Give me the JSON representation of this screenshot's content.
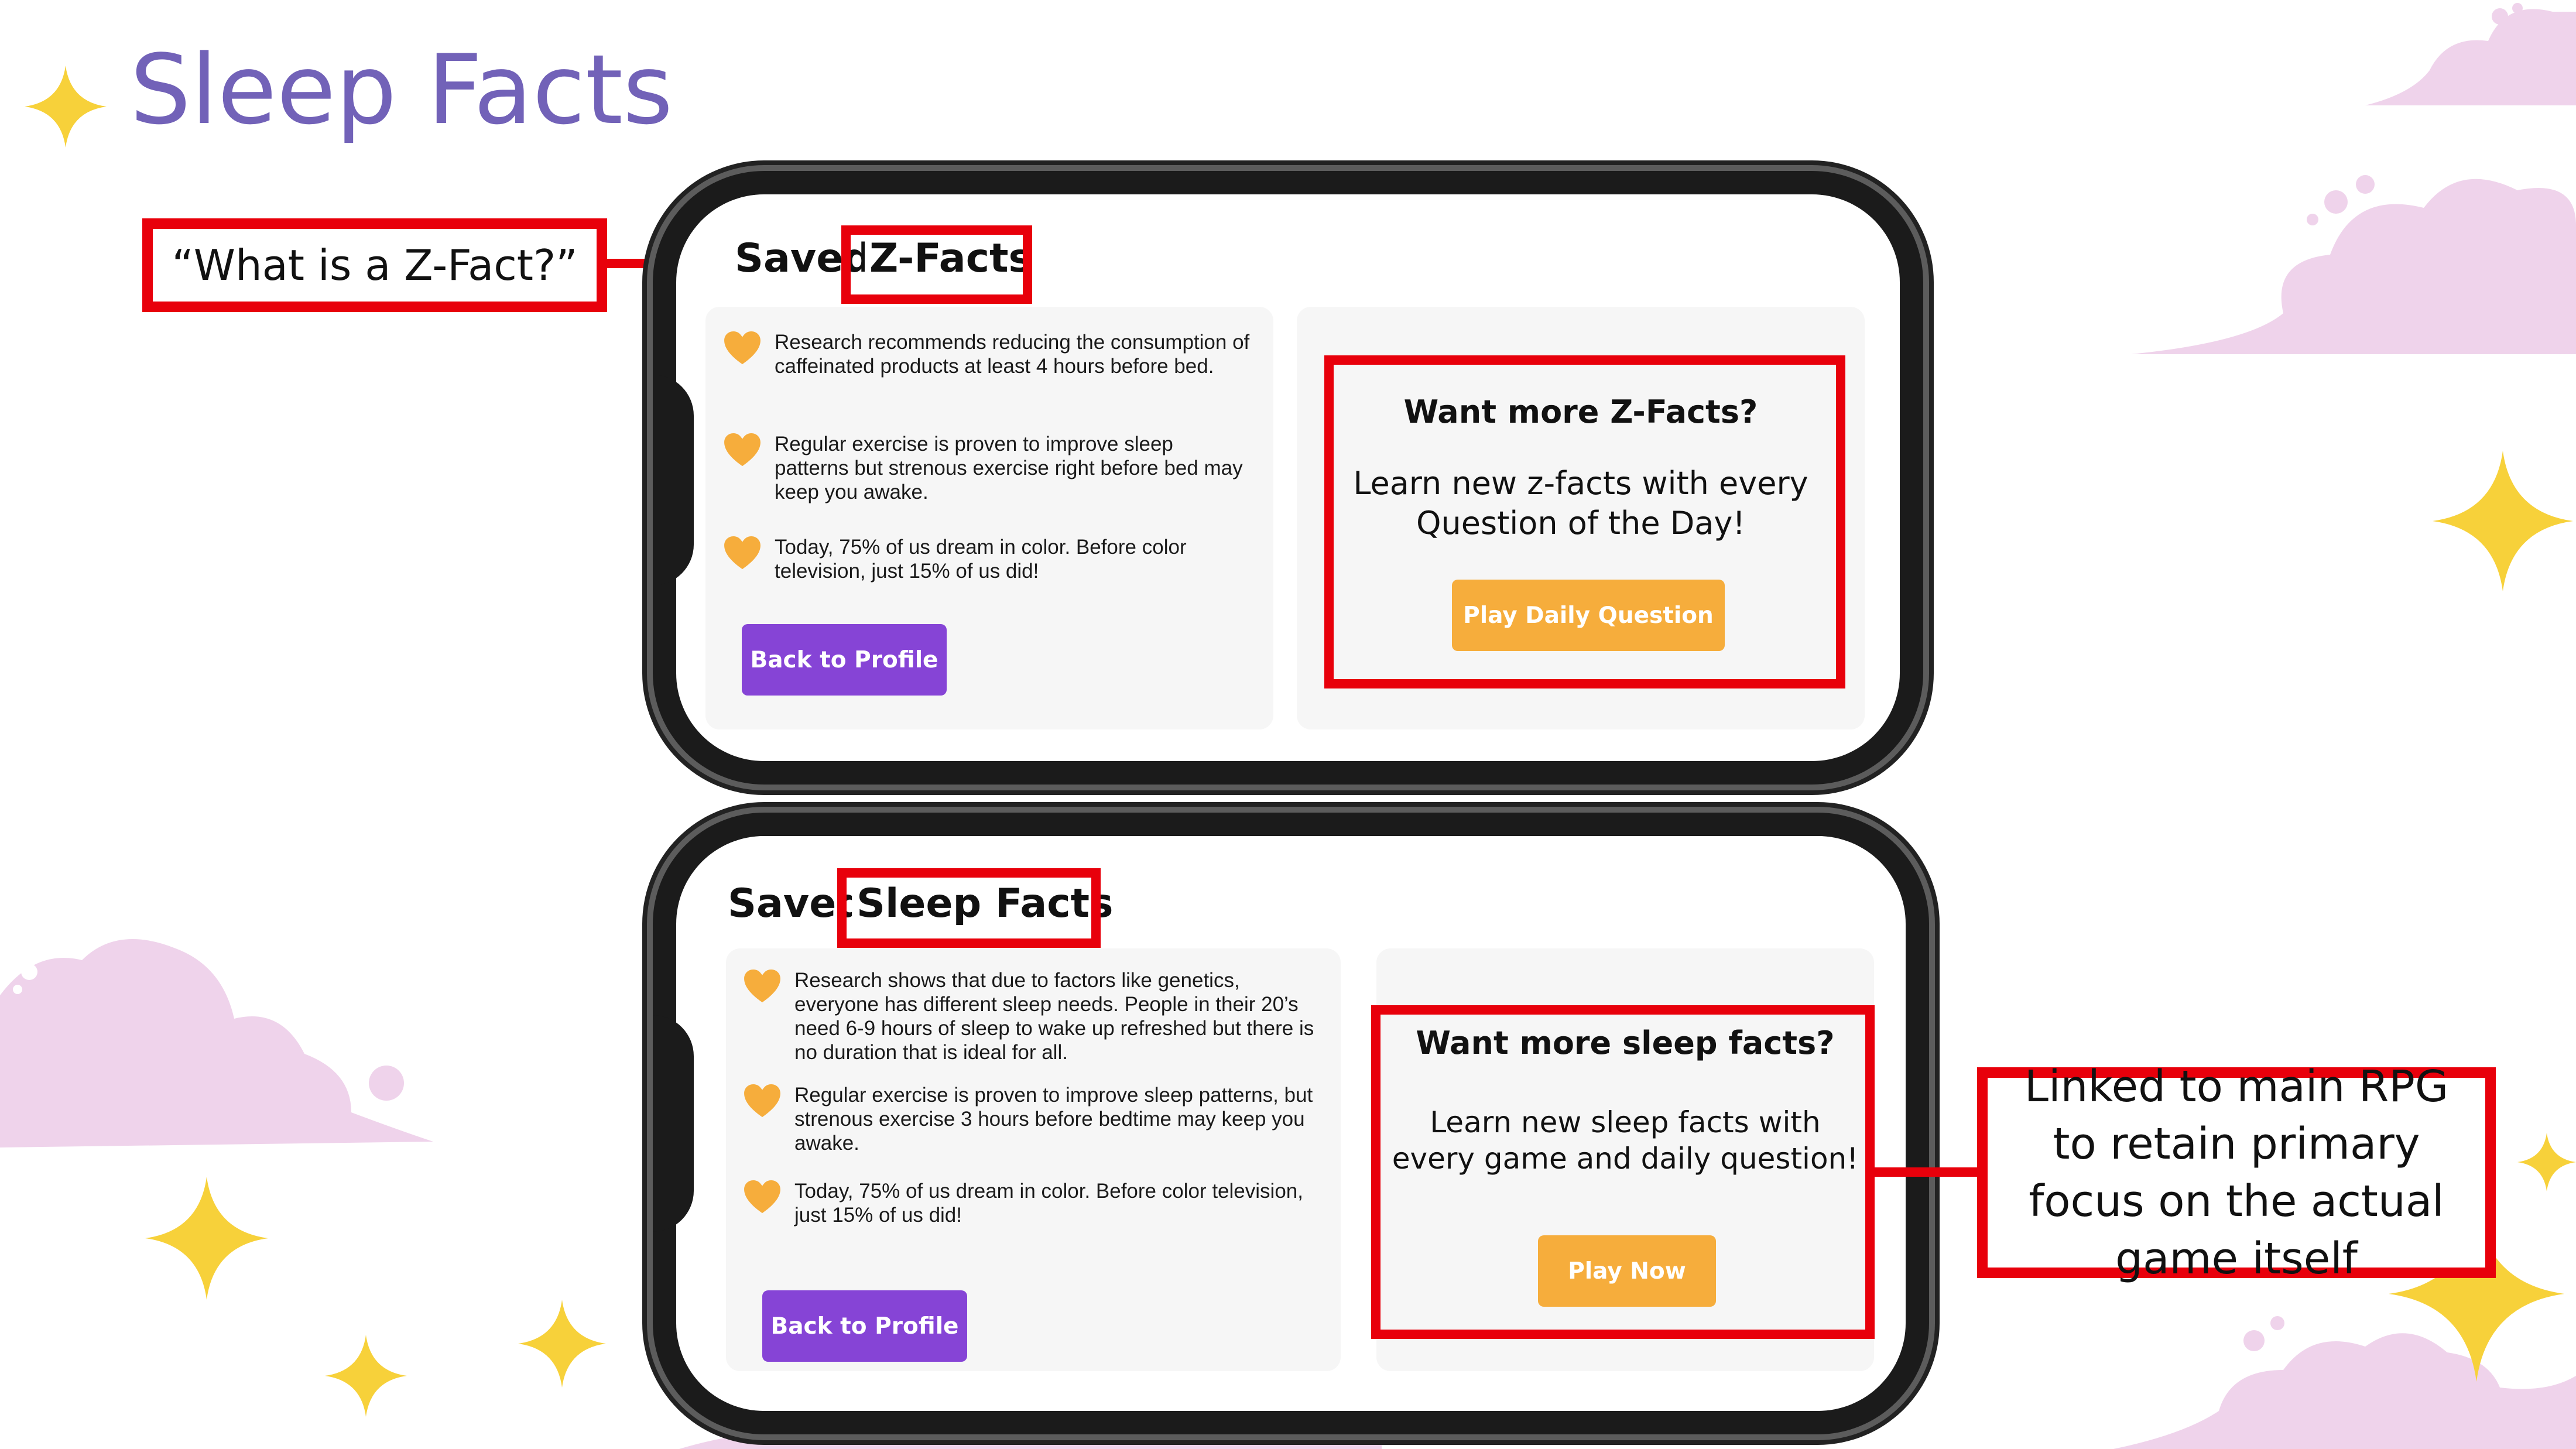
{
  "slide_title": "Sleep Facts",
  "colors": {
    "title": "#7262b8",
    "annotation_red": "#e8000b",
    "purple_button": "#8644d6",
    "orange_button": "#f6ad3c",
    "heart": "#f6ad3c",
    "sparkle": "#f7d13a",
    "cloud": "#efd3eb"
  },
  "callouts": {
    "zfact_question": "“What is a Z-Fact?”",
    "rpg_note": "Linked to main RPG to retain primary focus on the actual game itself"
  },
  "phone_top": {
    "heading_prefix": "Saved",
    "heading_highlight": "Z-Facts",
    "facts": [
      "Research recommends reducing the consumption of caffeinated products at least 4 hours before bed.",
      "Regular exercise is proven to improve sleep patterns but strenous exercise right before bed may keep you awake.",
      "Today, 75% of us dream in color. Before color television, just 15% of us did!"
    ],
    "back_button": "Back to Profile",
    "promo_title": "Want more Z-Facts?",
    "promo_text": "Learn new z-facts with every Question of the Day!",
    "promo_button": "Play Daily Question"
  },
  "phone_bottom": {
    "heading_prefix": "Saved",
    "heading_highlight": "Sleep Facts",
    "facts": [
      "Research shows that due to factors like genetics, everyone has different sleep needs. People in their 20’s need 6-9 hours of sleep to wake up refreshed but there is no duration that is ideal for all.",
      "Regular exercise is proven to improve sleep patterns, but strenous exercise 3 hours before bedtime may keep you awake.",
      "Today, 75% of us dream in color. Before color television, just 15% of us did!"
    ],
    "back_button": "Back to Profile",
    "promo_title": "Want more sleep facts?",
    "promo_text": "Learn new sleep facts with every game and daily question!",
    "promo_button": "Play Now"
  }
}
